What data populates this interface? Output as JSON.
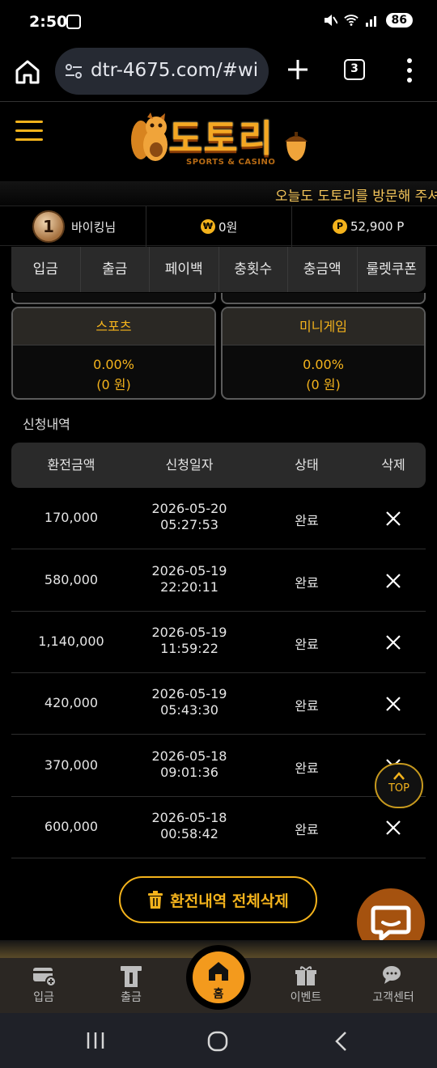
{
  "status_bar": {
    "time": "2:50",
    "battery": "86"
  },
  "browser": {
    "url": "dtr-4675.com/#wi",
    "tab_count": "3"
  },
  "site": {
    "logo_text": "도토리",
    "logo_sub": "SPORTS & CASINO",
    "marquee": "오늘도 도토리를 방문해 주셔"
  },
  "user": {
    "level": "1",
    "name": "바이킹님",
    "money": "0원",
    "points": "52,900 P"
  },
  "tabs": [
    "입금",
    "출금",
    "페이백",
    "충횟수",
    "충금액",
    "룰렛쿠폰"
  ],
  "rates": [
    {
      "title": "스포츠",
      "percent": "0.00%",
      "amount": "(0 원)"
    },
    {
      "title": "미니게임",
      "percent": "0.00%",
      "amount": "(0 원)"
    }
  ],
  "history": {
    "title": "신청내역",
    "headers": [
      "환전금액",
      "신청일자",
      "상태",
      "삭제"
    ],
    "rows": [
      {
        "amount": "170,000",
        "date": "2026-05-20",
        "time": "05:27:53",
        "status": "완료"
      },
      {
        "amount": "580,000",
        "date": "2026-05-19",
        "time": "22:20:11",
        "status": "완료"
      },
      {
        "amount": "1,140,000",
        "date": "2026-05-19",
        "time": "11:59:22",
        "status": "완료"
      },
      {
        "amount": "420,000",
        "date": "2026-05-19",
        "time": "05:43:30",
        "status": "완료"
      },
      {
        "amount": "370,000",
        "date": "2026-05-18",
        "time": "09:01:36",
        "status": "완료"
      },
      {
        "amount": "600,000",
        "date": "2026-05-18",
        "time": "00:58:42",
        "status": "완료"
      }
    ],
    "clear_all_label": "환전내역 전체삭제"
  },
  "top_label": "TOP",
  "bottom_nav": {
    "deposit": "입금",
    "withdraw": "출금",
    "home": "홈",
    "event": "이벤트",
    "support": "고객센터"
  },
  "colors": {
    "accent": "#f4b31c",
    "home": "#f39a1d",
    "chat": "#a5520f"
  }
}
